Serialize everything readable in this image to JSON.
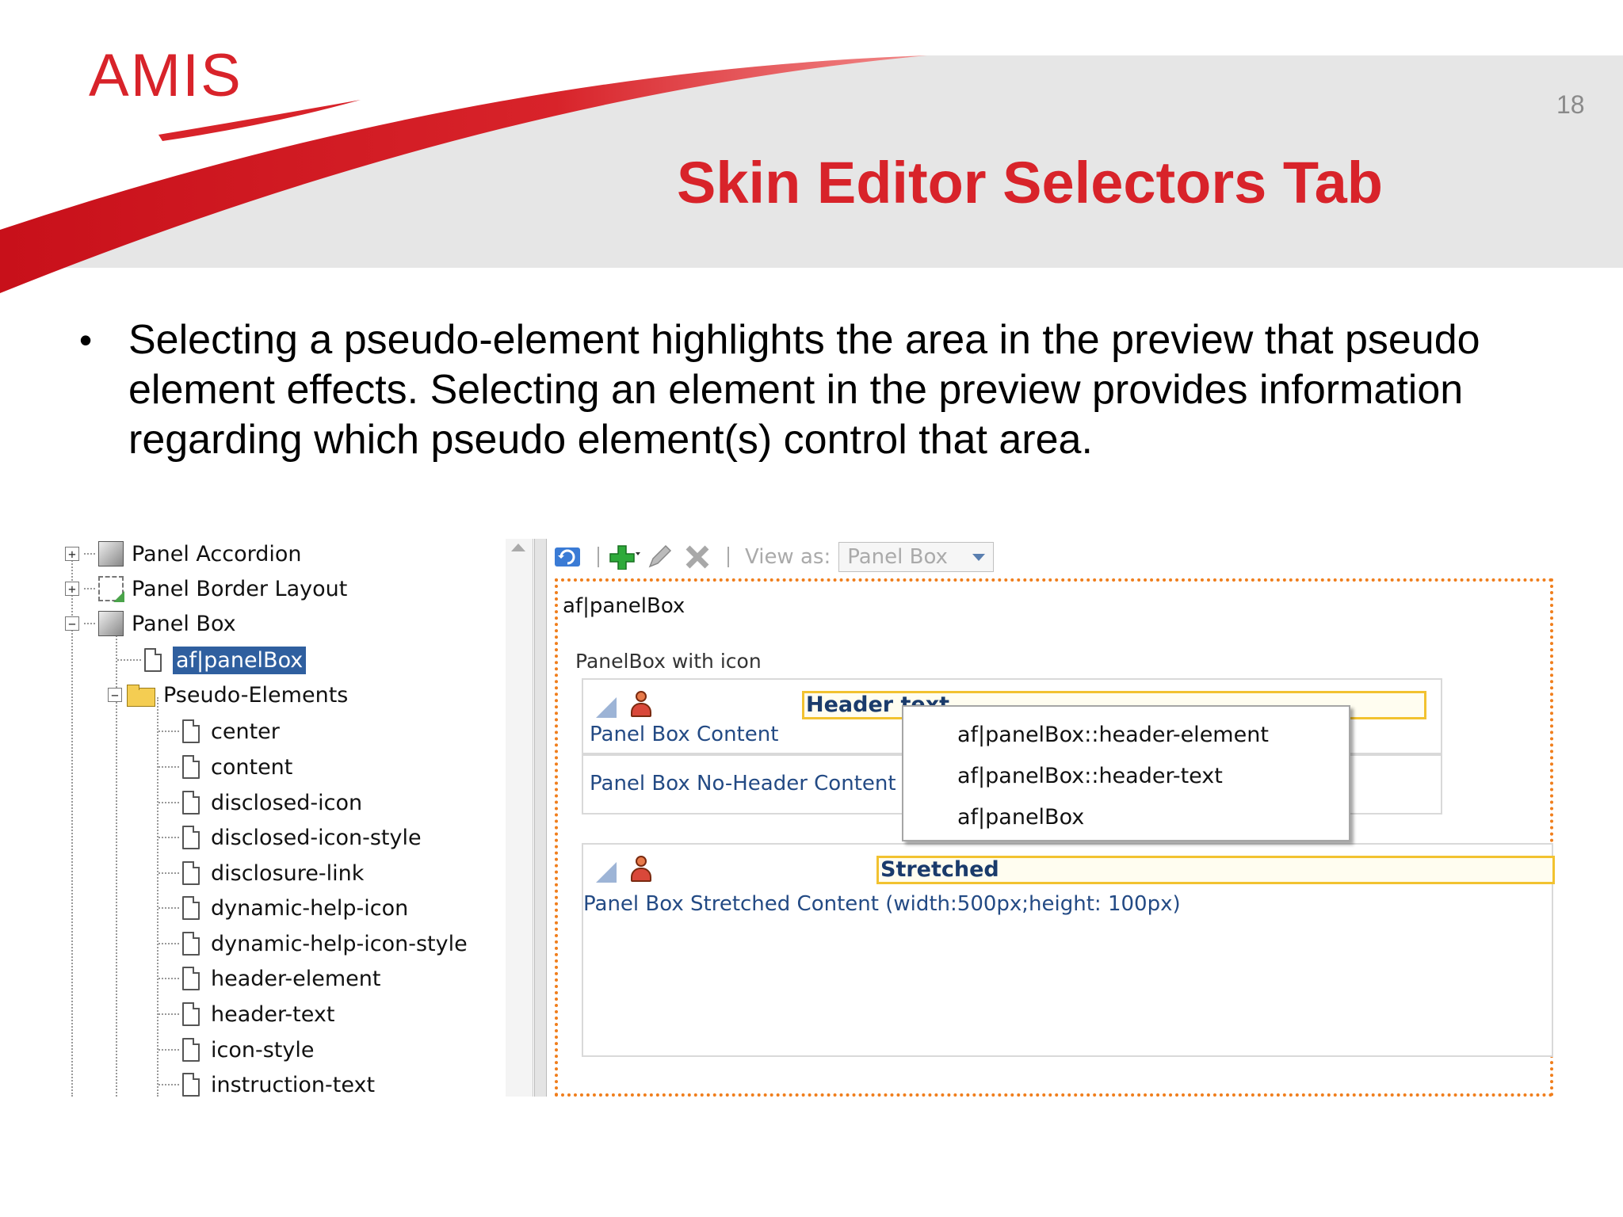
{
  "slide": {
    "logo_text": "AMIS",
    "page_number": "18",
    "title": "Skin Editor Selectors Tab",
    "bullet": "Selecting a pseudo-element highlights the area in the preview that pseudo element effects.  Selecting an element in the preview provides information regarding which pseudo element(s) control that area."
  },
  "colors": {
    "brand_red": "#d8232a",
    "selection_blue": "#2f5f9f",
    "highlight_orange": "#f07e1c",
    "field_yellow": "#f2c230"
  },
  "tree": {
    "components": [
      {
        "label": "Panel Accordion",
        "expander": "+"
      },
      {
        "label": "Panel Border Layout",
        "expander": "+"
      },
      {
        "label": "Panel Box",
        "expander": "−"
      }
    ],
    "selected_item": "af|panelBox",
    "folder_label": "Pseudo-Elements",
    "folder_expander": "−",
    "pseudo_elements": [
      "center",
      "content",
      "disclosed-icon",
      "disclosed-icon-style",
      "disclosure-link",
      "dynamic-help-icon",
      "dynamic-help-icon-style",
      "header-element",
      "header-text",
      "icon-style",
      "instruction-text"
    ]
  },
  "toolbar": {
    "view_as_label": "View as:",
    "view_as_value": "Panel Box",
    "icons": [
      "refresh-icon",
      "add-icon",
      "edit-icon",
      "delete-icon"
    ]
  },
  "preview": {
    "frame_label": "af|panelBox",
    "subtitle": "PanelBox with icon",
    "box1_header": "Header text",
    "box1_content": "Panel Box Content",
    "box2_content": "Panel Box No-Header Content",
    "box3_header": "Stretched",
    "box3_content": "Panel Box Stretched Content (width:500px;height: 100px)"
  },
  "context_menu": {
    "items": [
      "af|panelBox::header-element",
      "af|panelBox::header-text",
      "af|panelBox"
    ]
  }
}
